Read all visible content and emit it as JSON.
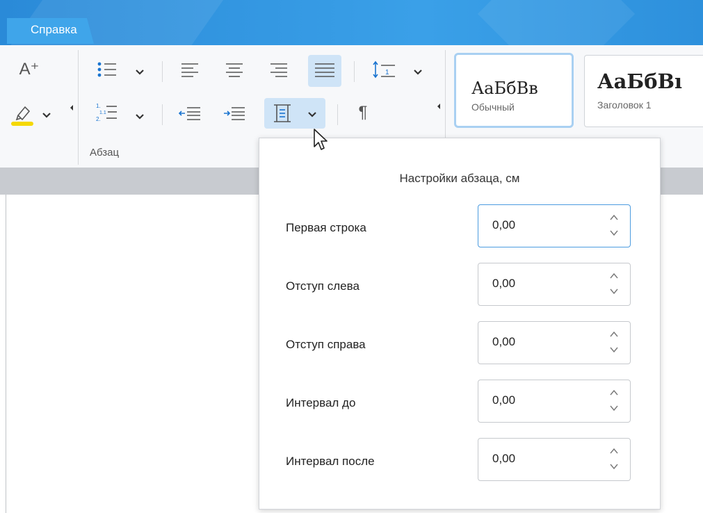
{
  "menubar": {
    "tab_label": "Справка"
  },
  "ribbon": {
    "group_label": "Абзац",
    "styles": [
      {
        "sample": "АаБбВв",
        "name": "Обычный",
        "selected": true
      },
      {
        "sample": "АаБбВı",
        "name": "Заголовок 1",
        "selected": false
      }
    ]
  },
  "popup": {
    "title": "Настройки абзаца, см",
    "rows": [
      {
        "label": "Первая строка",
        "value": "0,00"
      },
      {
        "label": "Отступ слева",
        "value": "0,00"
      },
      {
        "label": "Отступ справа",
        "value": "0,00"
      },
      {
        "label": "Интервал до",
        "value": "0,00"
      },
      {
        "label": "Интервал после",
        "value": "0,00"
      }
    ]
  },
  "icons": {
    "font_increase": "A⁺",
    "paragraph_mark": "¶"
  },
  "colors": {
    "accent": "#2a8ad8",
    "highlight_yellow": "#f5d800",
    "focus_border": "#4b9be0"
  }
}
